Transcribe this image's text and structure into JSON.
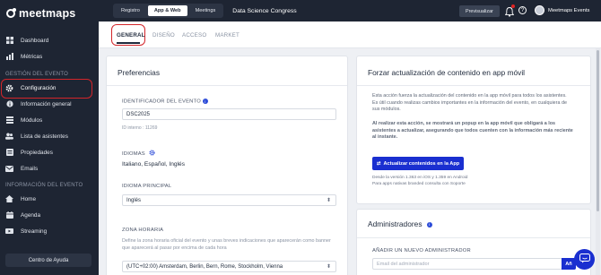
{
  "app": {
    "logo": "meetmaps"
  },
  "sidebar": {
    "items_top": [
      {
        "label": "Dashboard",
        "icon": "dashboard-icon"
      },
      {
        "label": "Métricas",
        "icon": "chart-icon"
      }
    ],
    "section_event": "GESTIÓN DEL EVENTO",
    "items_event": [
      {
        "label": "Configuración",
        "icon": "gear-icon"
      },
      {
        "label": "Información general",
        "icon": "info-icon"
      },
      {
        "label": "Módulos",
        "icon": "modules-icon"
      },
      {
        "label": "Lista de asistentes",
        "icon": "users-icon"
      },
      {
        "label": "Propiedades",
        "icon": "properties-icon"
      },
      {
        "label": "Emails",
        "icon": "email-icon"
      }
    ],
    "section_info": "INFORMACIÓN DEL EVENTO",
    "items_info": [
      {
        "label": "Home",
        "icon": "home-icon"
      },
      {
        "label": "Agenda",
        "icon": "calendar-icon"
      },
      {
        "label": "Streaming",
        "icon": "streaming-icon"
      }
    ],
    "help_button": "Centro de Ayuda"
  },
  "topbar": {
    "segments": [
      "Registro",
      "App & Web",
      "Meetings"
    ],
    "active_segment": "App & Web",
    "event_title": "Data Science Congress",
    "preview_button": "Previsualizar",
    "user_name": "Meetmaps Events"
  },
  "tabs": [
    "GENERAL",
    "DISEÑO",
    "ACCESO",
    "MARKET"
  ],
  "preferences": {
    "title": "Preferencias",
    "event_id_label": "IDENTIFICADOR DEL EVENTO",
    "event_id_value": "DSC2025",
    "internal_id": "ID interno : 11269",
    "languages_label": "IDIOMAS",
    "languages_value": "Italiano, Español, Inglés",
    "main_language_label": "IDIOMA PRINCIPAL",
    "main_language_value": "Inglés",
    "timezone_label": "ZONA HORARIA",
    "timezone_desc": "Define la zona horaria oficial del evento y unas breves indicaciones que aparecerán como banner que aparecerá al pasar por encima de cada hora",
    "timezone_value": "(UTC+02:00) Amsterdam, Berlin, Bern, Rome, Stockholm, Vienna"
  },
  "force_update": {
    "title": "Forzar actualización de contenido en app móvil",
    "description": "Esta acción fuerza la actualización del contenido en la app móvil para todos los asistentes. Es útil cuando realizas cambios importantes en la información del evento, en cualquiera de sus módulos.",
    "warning": "Al realizar esta acción, se mostrará un popup en la app móvil que obligará a los asistentes a actualizar, asegurando que todos cuenten con la información más reciente al instante.",
    "button": "Actualizar contenidos en la App",
    "version_note": "Desde la versión 1.363 en iOS y 1.359 en Android",
    "branded_note": "Para apps nativas branded consulta con Soporte"
  },
  "admins": {
    "title": "Administradores",
    "add_label": "AÑADIR UN NUEVO ADMINISTRADOR",
    "email_placeholder": "Email del administrador",
    "add_button": "Añ"
  },
  "colors": {
    "sidebar_bg": "#1e2533",
    "primary": "#1a2fd0",
    "highlight": "#d3252a"
  }
}
